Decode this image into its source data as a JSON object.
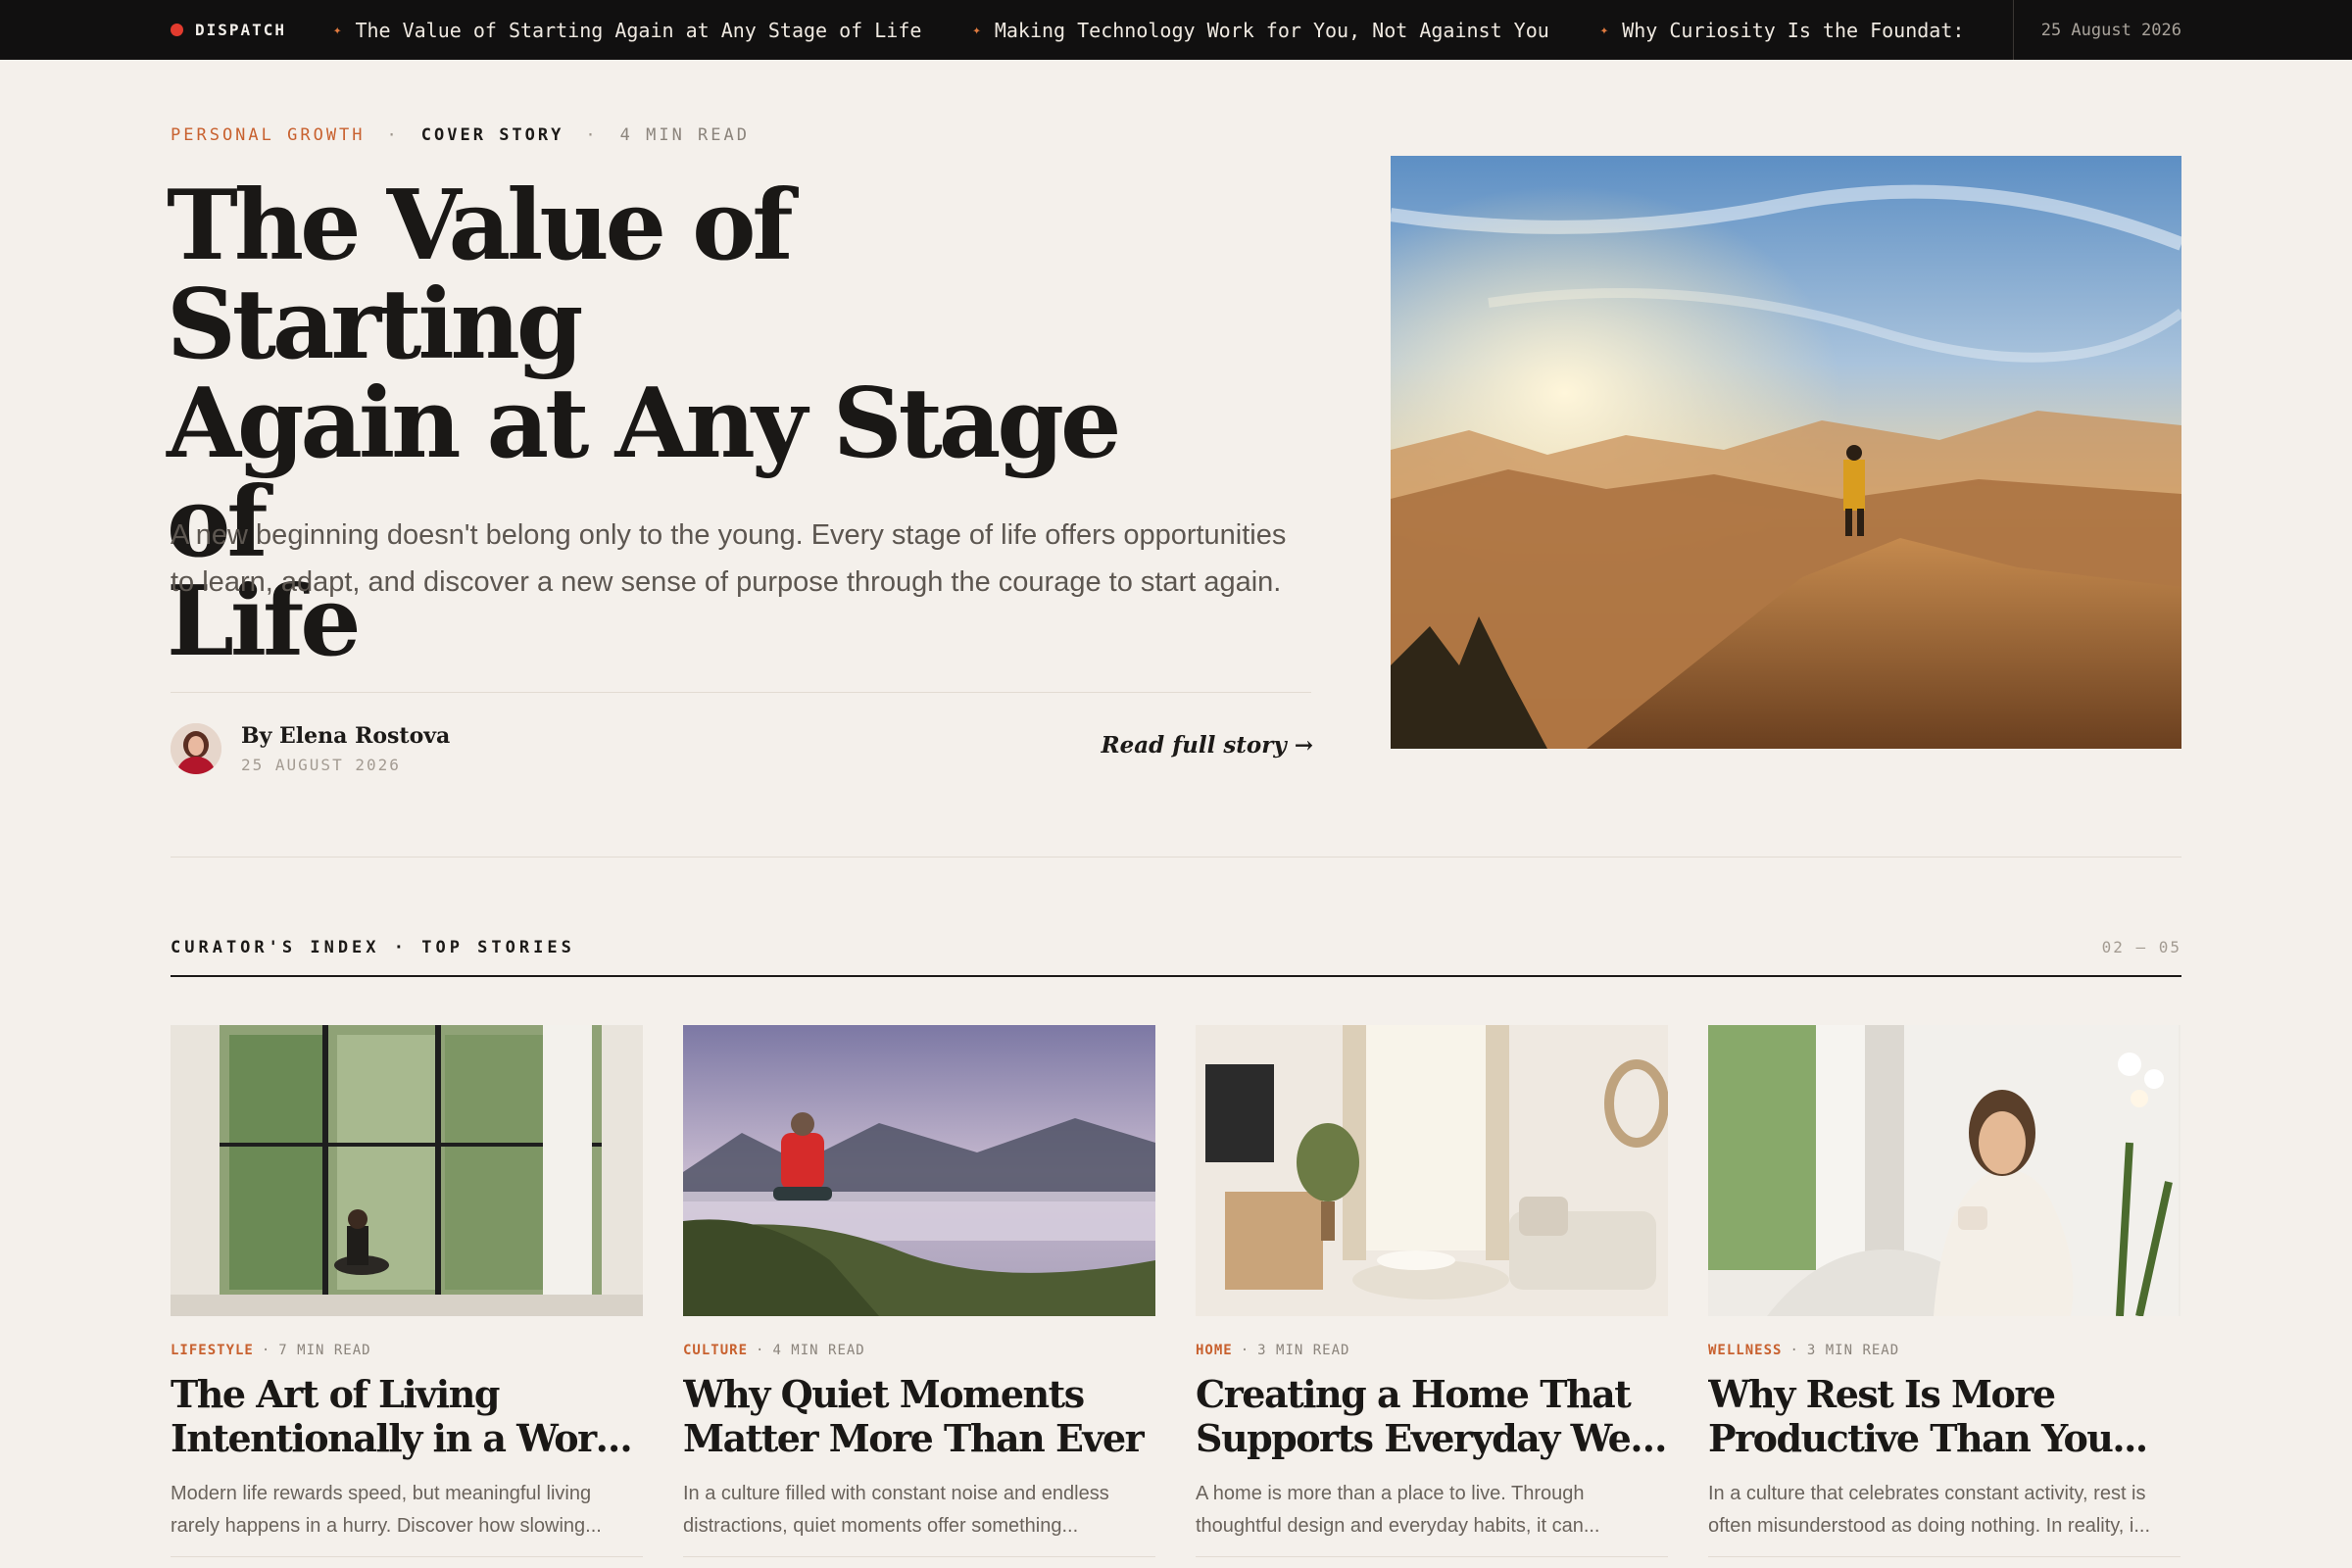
{
  "ticker": {
    "brand": "DISPATCH",
    "items": [
      "The Value of Starting Again at Any Stage of Life",
      "Making Technology Work for You, Not Against You",
      "Why Curiosity Is the Foundat:"
    ],
    "date": "25 August 2026"
  },
  "hero": {
    "category": "PERSONAL GROWTH",
    "label": "COVER STORY",
    "read_time": "4 MIN READ",
    "title_lines": [
      "The Value of Starting",
      "Again at Any Stage of",
      "Life"
    ],
    "description": "A new beginning doesn't belong only to the young. Every stage of life offers opportunities to learn, adapt, and discover a new sense of purpose through the courage to start again.",
    "author": "By Elena Rostova",
    "date": "25 AUGUST 2026",
    "cta": "Read full story →"
  },
  "index": {
    "label": "CURATOR'S INDEX · TOP STORIES",
    "page": "02 — 05"
  },
  "cards": [
    {
      "category": "LIFESTYLE",
      "read_time": "7 MIN READ",
      "title_lines": [
        "The Art of Living",
        "Intentionally in a World..."
      ],
      "excerpt_lines": [
        "Modern life rewards speed, but meaningful living",
        "rarely happens in a hurry. Discover how slowing..."
      ]
    },
    {
      "category": "CULTURE",
      "read_time": "4 MIN READ",
      "title_lines": [
        "Why Quiet Moments",
        "Matter More Than Ever"
      ],
      "excerpt_lines": [
        "In a culture filled with constant noise and endless",
        "distractions, quiet moments offer something..."
      ]
    },
    {
      "category": "HOME",
      "read_time": "3 MIN READ",
      "title_lines": [
        "Creating a Home That",
        "Supports Everyday Well-..."
      ],
      "excerpt_lines": [
        "A home is more than a place to live. Through",
        "thoughtful design and everyday habits, it can..."
      ]
    },
    {
      "category": "WELLNESS",
      "read_time": "3 MIN READ",
      "title_lines": [
        "Why Rest Is More",
        "Productive Than You..."
      ],
      "excerpt_lines": [
        "In a culture that celebrates constant activity, rest is",
        "often misunderstood as doing nothing. In reality, i..."
      ]
    }
  ],
  "colors": {
    "accent": "#c8612f",
    "ticker_bg": "#111010",
    "page_bg": "#f4f0eb"
  }
}
